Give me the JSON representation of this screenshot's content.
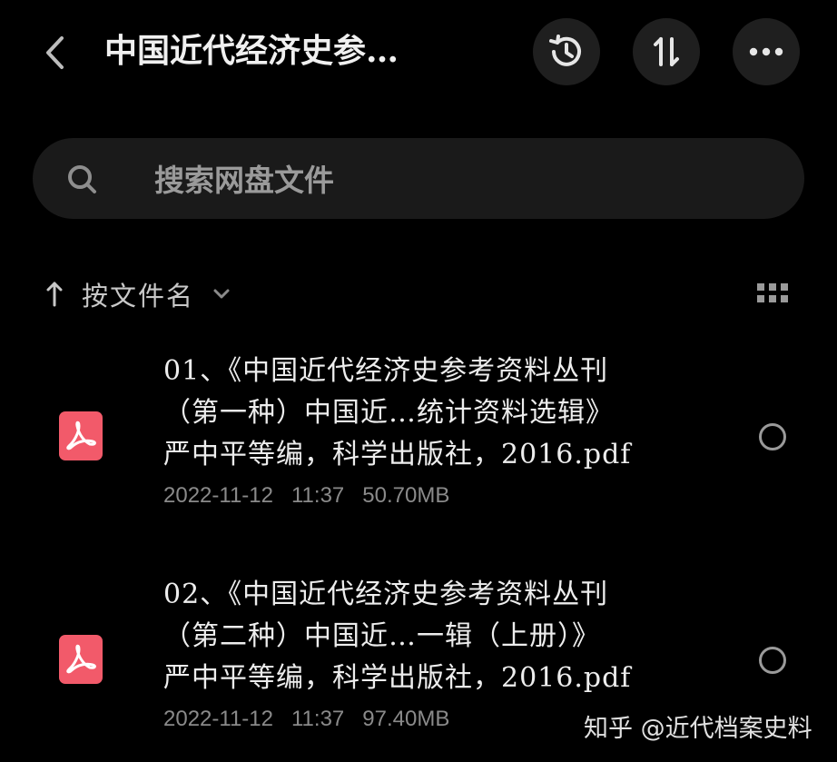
{
  "header": {
    "title": "中国近代经济史参…",
    "back_icon": "chevron-left-icon",
    "actions": [
      {
        "icon": "history-icon"
      },
      {
        "icon": "sort-arrows-icon"
      },
      {
        "icon": "more-horizontal-icon"
      }
    ]
  },
  "search": {
    "placeholder": "搜索网盘文件",
    "icon": "search-icon"
  },
  "sort": {
    "label": "按文件名",
    "direction": "ascending"
  },
  "files": [
    {
      "name": "01、《中国近代经济史参考资料丛刊\n（第一种）中国近…统计资料选辑》\n严中平等编，科学出版社，2016.pdf",
      "meta": "2022-11-12   11:37   50.70MB",
      "type": "pdf",
      "selected": false
    },
    {
      "name": "02、《中国近代经济史参考资料丛刊\n（第二种）中国近…一辑（上册）》\n严中平等编，科学出版社，2016.pdf",
      "meta": "2022-11-12   11:37   97.40MB",
      "type": "pdf",
      "selected": false
    }
  ],
  "watermark": "知乎 @近代档案史料",
  "colors": {
    "background": "#000000",
    "surface": "#1f1f1f",
    "pdf_brand": "#f25a6a",
    "text_primary": "#ededed",
    "text_secondary": "#8a8a8a"
  }
}
